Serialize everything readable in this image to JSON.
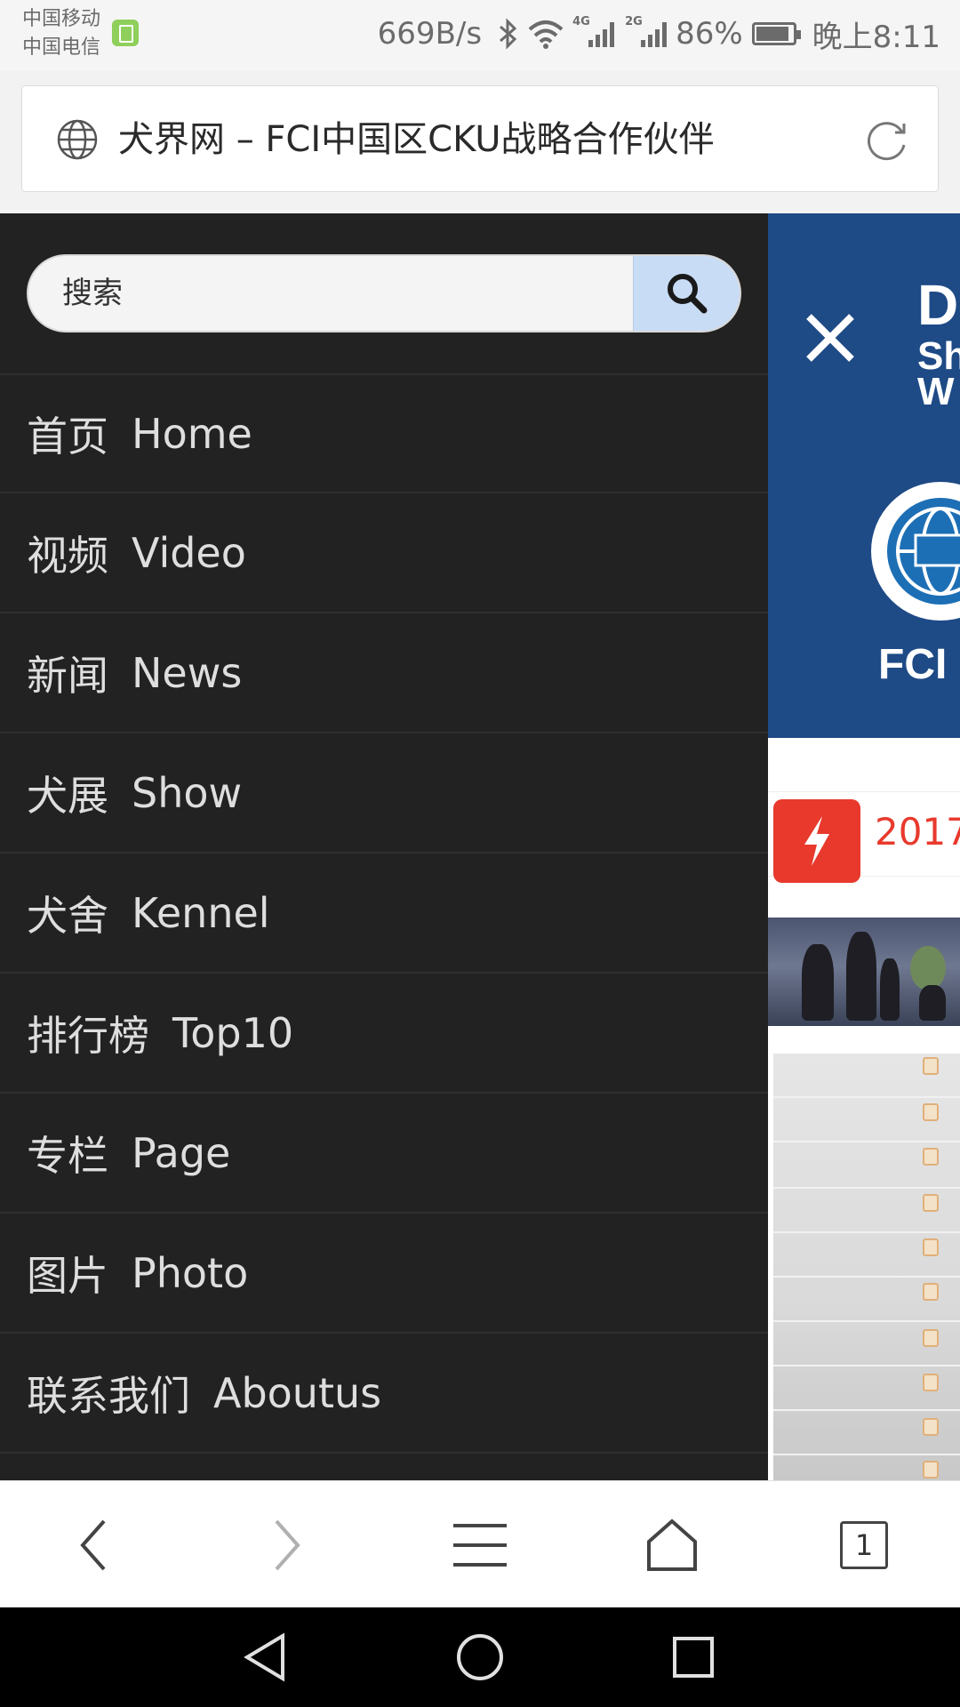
{
  "status_bar": {
    "carrier_1": "中国移动",
    "carrier_2": "中国电信",
    "net_speed": "669B/s",
    "network_1": "4G",
    "network_2": "2G",
    "battery": "86%",
    "time": "晚上8:11"
  },
  "address_bar": {
    "title": "犬界网 – FCI中国区CKU战略合作伙伴",
    "left_icon": "globe-icon",
    "right_icon": "reload-icon"
  },
  "drawer": {
    "search": {
      "placeholder": "搜索",
      "button_icon": "search-icon"
    },
    "menu": [
      {
        "zh": "首页",
        "en": "Home"
      },
      {
        "zh": "视频",
        "en": "Video"
      },
      {
        "zh": "新闻",
        "en": "News"
      },
      {
        "zh": "犬展",
        "en": "Show"
      },
      {
        "zh": "犬舍",
        "en": "Kennel"
      },
      {
        "zh": "排行榜",
        "en": "Top10"
      },
      {
        "zh": "专栏",
        "en": "Page"
      },
      {
        "zh": "图片",
        "en": "Photo"
      },
      {
        "zh": "联系我们",
        "en": "Aboutus"
      }
    ]
  },
  "background_page": {
    "banner_text_1": "D",
    "banner_text_2": "Sh",
    "banner_text_3": "W",
    "fci_text": "FCI",
    "news_year": "2017",
    "colors": {
      "banner": "#1e4a86",
      "accent": "#e8392c"
    }
  },
  "toolbar": {
    "back_icon": "back-icon",
    "forward_icon": "forward-icon",
    "menu_icon": "menu-icon",
    "home_icon": "home-icon",
    "tab_count": "1"
  },
  "nav_bar": {
    "back": "nav-back-icon",
    "home": "nav-home-icon",
    "recents": "nav-recents-icon"
  }
}
